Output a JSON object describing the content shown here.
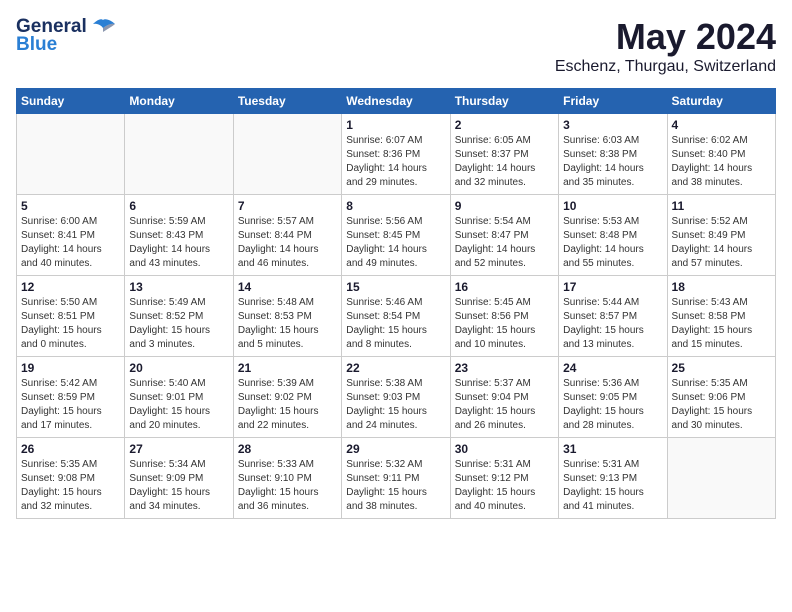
{
  "logo": {
    "line1": "General",
    "line2": "Blue"
  },
  "title": "May 2024",
  "subtitle": "Eschenz, Thurgau, Switzerland",
  "days_of_week": [
    "Sunday",
    "Monday",
    "Tuesday",
    "Wednesday",
    "Thursday",
    "Friday",
    "Saturday"
  ],
  "weeks": [
    [
      {
        "num": "",
        "info": ""
      },
      {
        "num": "",
        "info": ""
      },
      {
        "num": "",
        "info": ""
      },
      {
        "num": "1",
        "info": "Sunrise: 6:07 AM\nSunset: 8:36 PM\nDaylight: 14 hours\nand 29 minutes."
      },
      {
        "num": "2",
        "info": "Sunrise: 6:05 AM\nSunset: 8:37 PM\nDaylight: 14 hours\nand 32 minutes."
      },
      {
        "num": "3",
        "info": "Sunrise: 6:03 AM\nSunset: 8:38 PM\nDaylight: 14 hours\nand 35 minutes."
      },
      {
        "num": "4",
        "info": "Sunrise: 6:02 AM\nSunset: 8:40 PM\nDaylight: 14 hours\nand 38 minutes."
      }
    ],
    [
      {
        "num": "5",
        "info": "Sunrise: 6:00 AM\nSunset: 8:41 PM\nDaylight: 14 hours\nand 40 minutes."
      },
      {
        "num": "6",
        "info": "Sunrise: 5:59 AM\nSunset: 8:43 PM\nDaylight: 14 hours\nand 43 minutes."
      },
      {
        "num": "7",
        "info": "Sunrise: 5:57 AM\nSunset: 8:44 PM\nDaylight: 14 hours\nand 46 minutes."
      },
      {
        "num": "8",
        "info": "Sunrise: 5:56 AM\nSunset: 8:45 PM\nDaylight: 14 hours\nand 49 minutes."
      },
      {
        "num": "9",
        "info": "Sunrise: 5:54 AM\nSunset: 8:47 PM\nDaylight: 14 hours\nand 52 minutes."
      },
      {
        "num": "10",
        "info": "Sunrise: 5:53 AM\nSunset: 8:48 PM\nDaylight: 14 hours\nand 55 minutes."
      },
      {
        "num": "11",
        "info": "Sunrise: 5:52 AM\nSunset: 8:49 PM\nDaylight: 14 hours\nand 57 minutes."
      }
    ],
    [
      {
        "num": "12",
        "info": "Sunrise: 5:50 AM\nSunset: 8:51 PM\nDaylight: 15 hours\nand 0 minutes."
      },
      {
        "num": "13",
        "info": "Sunrise: 5:49 AM\nSunset: 8:52 PM\nDaylight: 15 hours\nand 3 minutes."
      },
      {
        "num": "14",
        "info": "Sunrise: 5:48 AM\nSunset: 8:53 PM\nDaylight: 15 hours\nand 5 minutes."
      },
      {
        "num": "15",
        "info": "Sunrise: 5:46 AM\nSunset: 8:54 PM\nDaylight: 15 hours\nand 8 minutes."
      },
      {
        "num": "16",
        "info": "Sunrise: 5:45 AM\nSunset: 8:56 PM\nDaylight: 15 hours\nand 10 minutes."
      },
      {
        "num": "17",
        "info": "Sunrise: 5:44 AM\nSunset: 8:57 PM\nDaylight: 15 hours\nand 13 minutes."
      },
      {
        "num": "18",
        "info": "Sunrise: 5:43 AM\nSunset: 8:58 PM\nDaylight: 15 hours\nand 15 minutes."
      }
    ],
    [
      {
        "num": "19",
        "info": "Sunrise: 5:42 AM\nSunset: 8:59 PM\nDaylight: 15 hours\nand 17 minutes."
      },
      {
        "num": "20",
        "info": "Sunrise: 5:40 AM\nSunset: 9:01 PM\nDaylight: 15 hours\nand 20 minutes."
      },
      {
        "num": "21",
        "info": "Sunrise: 5:39 AM\nSunset: 9:02 PM\nDaylight: 15 hours\nand 22 minutes."
      },
      {
        "num": "22",
        "info": "Sunrise: 5:38 AM\nSunset: 9:03 PM\nDaylight: 15 hours\nand 24 minutes."
      },
      {
        "num": "23",
        "info": "Sunrise: 5:37 AM\nSunset: 9:04 PM\nDaylight: 15 hours\nand 26 minutes."
      },
      {
        "num": "24",
        "info": "Sunrise: 5:36 AM\nSunset: 9:05 PM\nDaylight: 15 hours\nand 28 minutes."
      },
      {
        "num": "25",
        "info": "Sunrise: 5:35 AM\nSunset: 9:06 PM\nDaylight: 15 hours\nand 30 minutes."
      }
    ],
    [
      {
        "num": "26",
        "info": "Sunrise: 5:35 AM\nSunset: 9:08 PM\nDaylight: 15 hours\nand 32 minutes."
      },
      {
        "num": "27",
        "info": "Sunrise: 5:34 AM\nSunset: 9:09 PM\nDaylight: 15 hours\nand 34 minutes."
      },
      {
        "num": "28",
        "info": "Sunrise: 5:33 AM\nSunset: 9:10 PM\nDaylight: 15 hours\nand 36 minutes."
      },
      {
        "num": "29",
        "info": "Sunrise: 5:32 AM\nSunset: 9:11 PM\nDaylight: 15 hours\nand 38 minutes."
      },
      {
        "num": "30",
        "info": "Sunrise: 5:31 AM\nSunset: 9:12 PM\nDaylight: 15 hours\nand 40 minutes."
      },
      {
        "num": "31",
        "info": "Sunrise: 5:31 AM\nSunset: 9:13 PM\nDaylight: 15 hours\nand 41 minutes."
      },
      {
        "num": "",
        "info": ""
      }
    ]
  ]
}
